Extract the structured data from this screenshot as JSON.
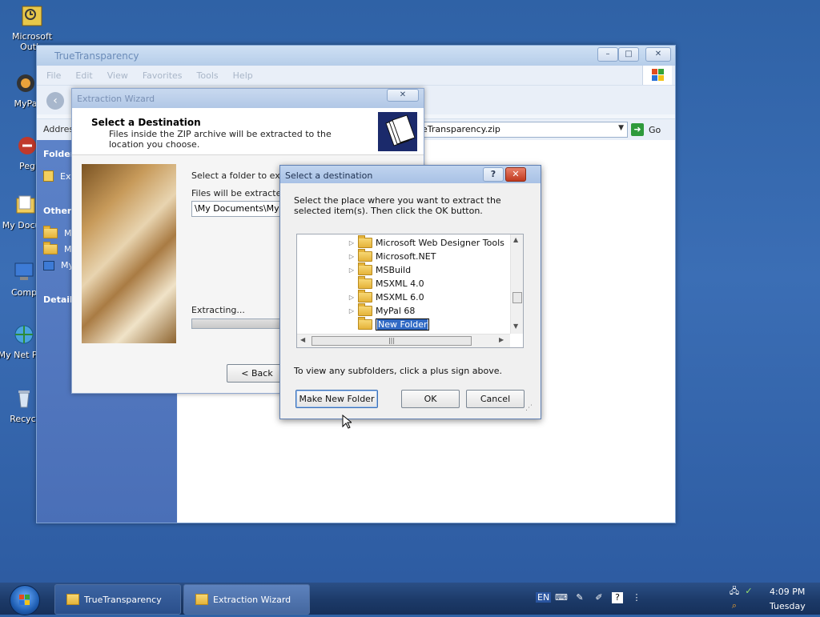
{
  "desktop": {
    "icons": [
      {
        "label": "Microsoft Outlo"
      },
      {
        "label": "MyPa"
      },
      {
        "label": "Peg"
      },
      {
        "label": "My Docum"
      },
      {
        "label": "Comp"
      },
      {
        "label": "My Net Plac"
      },
      {
        "label": "Recycl"
      }
    ]
  },
  "explorer": {
    "title": "TrueTransparency",
    "menu": [
      "File",
      "Edit",
      "View",
      "Favorites",
      "Tools",
      "Help"
    ],
    "address_label": "Addres",
    "address_value": "eTransparency.zip",
    "go_label": "Go",
    "left_pane": {
      "folder_section": "Folder",
      "folder_item": "Ext",
      "other_section": "Other I",
      "other_items": [
        "My",
        "My",
        "My"
      ],
      "details_section": "Details"
    }
  },
  "wizard": {
    "title": "Extraction Wizard",
    "header_title": "Select a Destination",
    "header_subtitle": "Files inside the ZIP archive will be extracted to the location you choose.",
    "select_folder_text": "Select a folder to extrac",
    "files_extracted_text": "Files will be extracted to",
    "path_value": "\\My Documents\\My Do",
    "extracting_text": "Extracting...",
    "back_button": "< Back"
  },
  "dialog": {
    "title": "Select a destination",
    "instructions": "Select the place where you want to extract the selected item(s).  Then click the OK button.",
    "tree_items": [
      {
        "label": "Microsoft Web Designer Tools",
        "expandable": true
      },
      {
        "label": "Microsoft.NET",
        "expandable": true
      },
      {
        "label": "MSBuild",
        "expandable": true
      },
      {
        "label": "MSXML 4.0",
        "expandable": false
      },
      {
        "label": "MSXML 6.0",
        "expandable": true
      },
      {
        "label": "MyPal 68",
        "expandable": true
      }
    ],
    "new_folder_value": "New Folder",
    "hint": "To view any subfolders, click a plus sign above.",
    "make_new_folder_button": "Make New Folder",
    "ok_button": "OK",
    "cancel_button": "Cancel"
  },
  "taskbar": {
    "tasks": [
      {
        "label": "TrueTransparency"
      },
      {
        "label": "Extraction Wizard"
      }
    ],
    "language": "EN",
    "time": "4:09 PM",
    "day": "Tuesday"
  }
}
